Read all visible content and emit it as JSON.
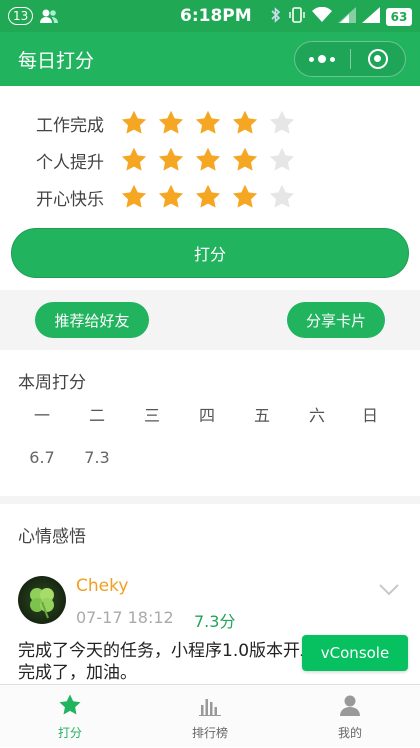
{
  "status_bar": {
    "notification_count": "13",
    "time": "6:18PM",
    "battery": "63"
  },
  "nav": {
    "title": "每日打分"
  },
  "rating": {
    "rows": [
      {
        "label": "工作完成",
        "stars": 4,
        "max": 5
      },
      {
        "label": "个人提升",
        "stars": 4,
        "max": 5
      },
      {
        "label": "开心快乐",
        "stars": 4,
        "max": 5
      }
    ],
    "submit_label": "打分"
  },
  "share": {
    "recommend_label": "推荐给好友",
    "card_label": "分享卡片"
  },
  "week": {
    "title": "本周打分",
    "days": [
      "一",
      "二",
      "三",
      "四",
      "五",
      "六",
      "日"
    ],
    "scores": [
      "6.7",
      "7.3"
    ]
  },
  "mood": {
    "title": "心情感悟",
    "post": {
      "user": "Cheky",
      "time": "07-17 18:12",
      "score": "7.3分",
      "text": "完成了今天的任务，小程序1.0版本开发完成了，加油。"
    }
  },
  "vconsole_label": "vConsole",
  "tabs": [
    {
      "label": "打分",
      "icon": "star-icon",
      "active": true
    },
    {
      "label": "排行榜",
      "icon": "bar-chart-icon",
      "active": false
    },
    {
      "label": "我的",
      "icon": "user-icon",
      "active": false
    }
  ],
  "colors": {
    "brand": "#22b35f",
    "star_on": "#f5a623",
    "star_off": "#e6e6e6",
    "name": "#f0a020"
  }
}
